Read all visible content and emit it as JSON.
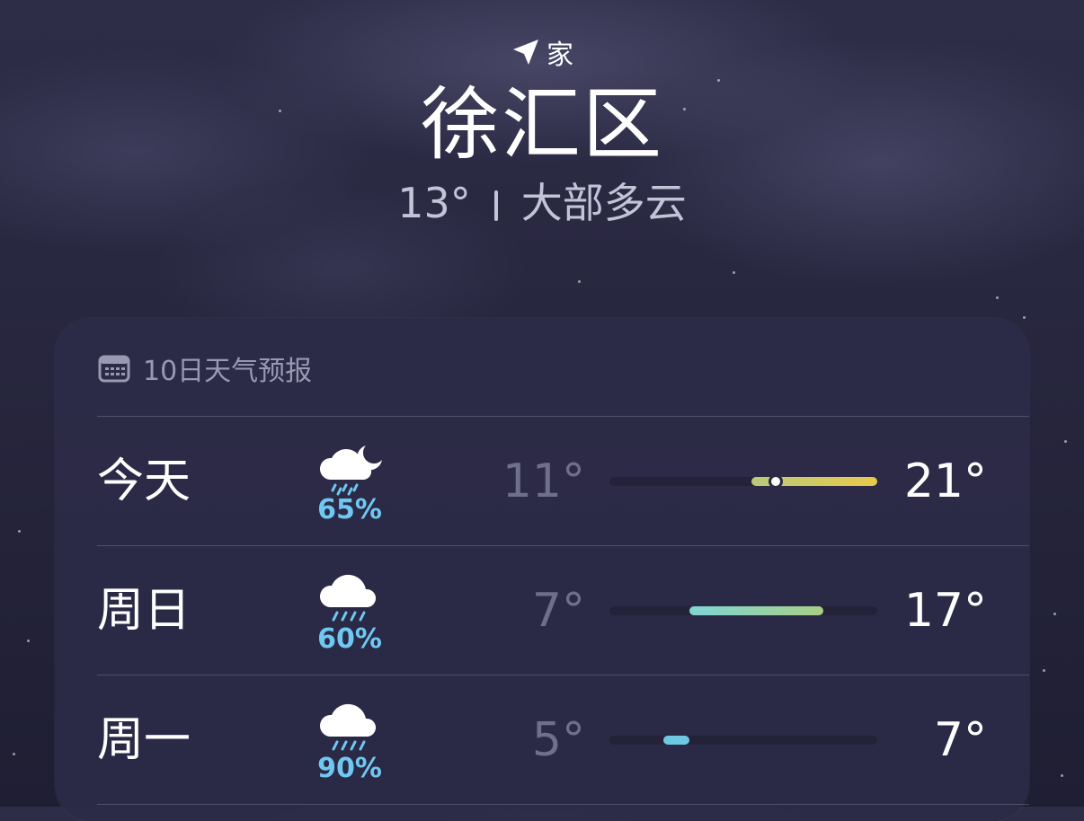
{
  "location": {
    "label": "家",
    "icon": "location-arrow-icon",
    "city": "徐汇区",
    "temperature": "13°",
    "condition": "大部多云"
  },
  "forecast": {
    "title": "10日天气预报",
    "icon": "calendar-icon",
    "days": [
      {
        "day": "今天",
        "icon": "cloud-moon-rain-icon",
        "precip": "65%",
        "low": "11°",
        "high": "21°",
        "range_start": 0.53,
        "range_end": 1.0,
        "current": 0.62,
        "colors": [
          "#b9c97a",
          "#e9c94a"
        ]
      },
      {
        "day": "周日",
        "icon": "cloud-rain-icon",
        "precip": "60%",
        "low": "7°",
        "high": "17°",
        "range_start": 0.3,
        "range_end": 0.8,
        "colors": [
          "#7fd6d4",
          "#a8cf86"
        ]
      },
      {
        "day": "周一",
        "icon": "cloud-rain-icon",
        "precip": "90%",
        "low": "5°",
        "high": "7°",
        "range_start": 0.2,
        "range_end": 0.3,
        "colors": [
          "#6fc8e3",
          "#6fc8e3"
        ]
      }
    ]
  }
}
